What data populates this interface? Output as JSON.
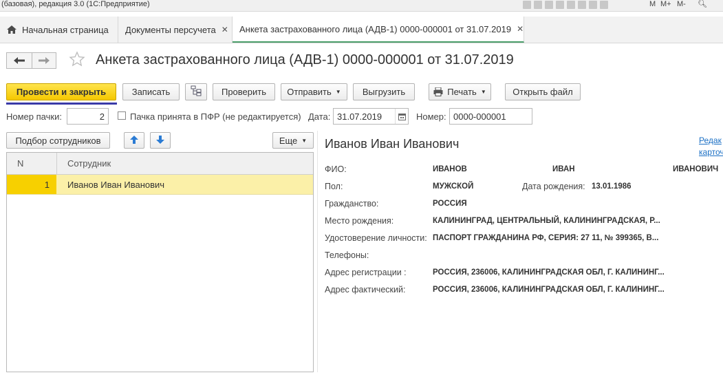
{
  "window": {
    "title": "(базовая), редакция 3.0 (1С:Предприятие)",
    "title_controls": [
      "M",
      "M+",
      "M-"
    ]
  },
  "tabs": [
    {
      "label": "Начальная страница",
      "icon": "home-icon"
    },
    {
      "label": "Документы персучета",
      "close": "✕"
    },
    {
      "label": "Анкета застрахованного лица (АДВ-1) 0000-000001 от 31.07.2019",
      "close": "✕"
    }
  ],
  "nav": {
    "back": "🡐",
    "forward": "🡒",
    "favorite": "☆"
  },
  "page_title": "Анкета застрахованного лица (АДВ-1) 0000-000001 от 31.07.2019",
  "toolbar": {
    "post_close": "Провести и закрыть",
    "save": "Записать",
    "check": "Проверить",
    "send": "Отправить",
    "export": "Выгрузить",
    "print": "Печать",
    "open_file": "Открыть файл"
  },
  "fields": {
    "batch_label": "Номер пачки:",
    "batch_value": "2",
    "accepted_label": "Пачка принята в ПФР (не редактируется)",
    "date_label": "Дата:",
    "date_value": "31.07.2019",
    "number_label": "Номер:",
    "number_value": "0000-000001"
  },
  "employees": {
    "select_button": "Подбор сотрудников",
    "more_button": "Еще",
    "columns": [
      "N",
      "Сотрудник"
    ],
    "rows": [
      {
        "n": "1",
        "name": "Иванов Иван Иванович"
      }
    ]
  },
  "details": {
    "name": "Иванов Иван Иванович",
    "edit_link_1": "Редак",
    "edit_link_2": "карточ",
    "fio_label": "ФИО:",
    "last_name": "ИВАНОВ",
    "first_name": "ИВАН",
    "patronymic": "ИВАНОВИЧ",
    "gender_label": "Пол:",
    "gender": "МУЖСКОЙ",
    "birth_label": "Дата рождения:",
    "birth_date": "13.01.1986",
    "citizenship_label": "Гражданство:",
    "citizenship": "РОССИЯ",
    "birthplace_label": "Место рождения:",
    "birthplace": "КАЛИНИНГРАД, ЦЕНТРАЛЬНЫЙ, КАЛИНИНГРАДСКАЯ, Р...",
    "id_label": "Удостоверение личности:",
    "id_doc": "ПАСПОРТ ГРАЖДАНИНА РФ, СЕРИЯ: 27 11, № 399365, В...",
    "phones_label": "Телефоны:",
    "reg_label": "Адрес регистрации :",
    "reg_address": "РОССИЯ, 236006, КАЛИНИНГРАДСКАЯ ОБЛ, Г. КАЛИНИНГ...",
    "actual_label": "Адрес фактический:",
    "actual_address": "РОССИЯ, 236006, КАЛИНИНГРАДСКАЯ ОБЛ, Г. КАЛИНИНГ..."
  },
  "colors": {
    "accent_yellow": "#f5c800",
    "active_tab_line": "#4b9e6a",
    "link": "#1a6fc4",
    "row_highlight": "#fbf0a8"
  }
}
